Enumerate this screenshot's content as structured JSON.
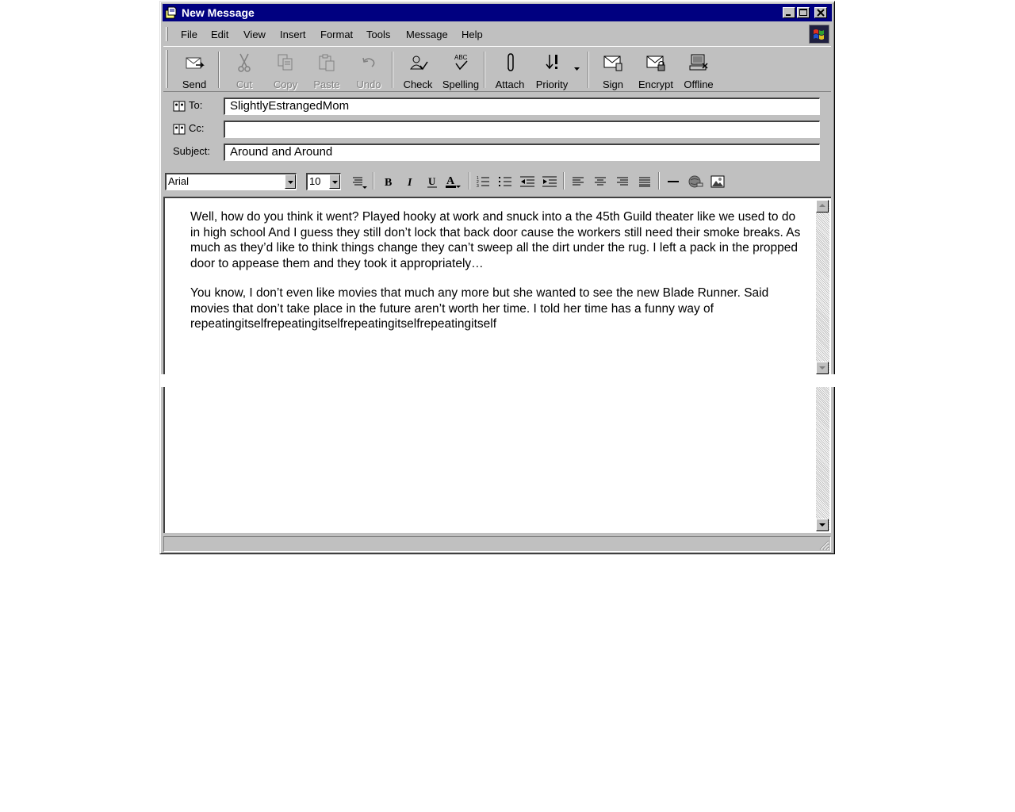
{
  "window": {
    "title": "New Message",
    "title_icon": "compose-envelope-icon",
    "buttons": [
      "minimize-icon",
      "maximize-icon",
      "close-icon"
    ]
  },
  "menubar": {
    "items": [
      {
        "label": "File"
      },
      {
        "label": "Edit"
      },
      {
        "label": "View"
      },
      {
        "label": "Insert"
      },
      {
        "label": "Format"
      },
      {
        "label": "Tools"
      },
      {
        "label": "Message"
      },
      {
        "label": "Help"
      }
    ]
  },
  "toolbar": {
    "send": "Send",
    "cut": "Cut",
    "copy": "Copy",
    "paste": "Paste",
    "undo": "Undo",
    "check": "Check",
    "spelling": "Spelling",
    "attach": "Attach",
    "priority": "Priority",
    "sign": "Sign",
    "encrypt": "Encrypt",
    "offline": "Offline"
  },
  "header": {
    "to_label": "To:",
    "to_value": "SlightlyEstrangedMom",
    "cc_label": "Cc:",
    "cc_value": "",
    "subject_label": "Subject:",
    "subject_value": "Around and Around"
  },
  "format": {
    "font": "Arial",
    "size": "10"
  },
  "body": {
    "paragraph1": "Well, how do you think it went? Played hooky at work and snuck into a the 45th Guild theater like we used to do in high school And I guess they still don’t lock that back door cause the workers still need their smoke breaks. As much as they’d like to think things change they can’t sweep all the dirt under the rug. I left a pack in the propped door to appease them and they took it appropriately…",
    "paragraph2": "You know, I don’t even like movies that much any more but she wanted to see the new Blade Runner. Said movies that don’t take place in the future aren’t worth her time. I told her time has a funny way of repeatingitselfrepeatingitselfrepeatingitselfrepeatingitself"
  },
  "colors": {
    "titlebar": "#000080",
    "chrome": "#c0c0c0"
  }
}
